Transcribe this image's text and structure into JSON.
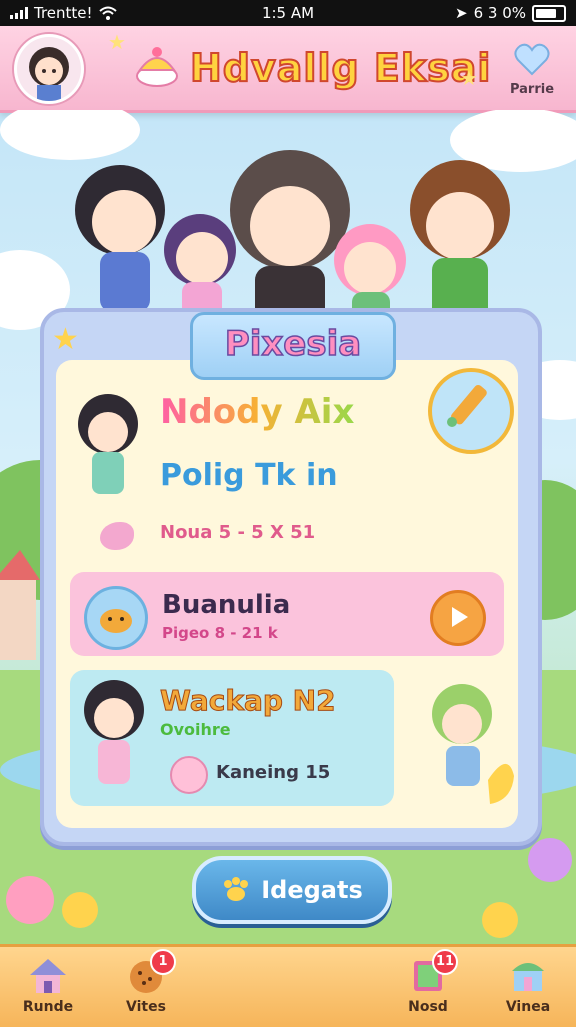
{
  "status": {
    "carrier": "Trentte!",
    "time": "1:5 AM",
    "battery": "6 3 0%"
  },
  "header": {
    "title": "Hdvallg Eksai",
    "profile_label": "Parrie"
  },
  "panel": {
    "ribbon": "Pixesia",
    "card1": {
      "title": "Ndody Aix",
      "subtitle": "Polig Tk in",
      "meta": "Noua 5 - 5 X 51"
    },
    "card2": {
      "title": "Buanulia",
      "meta": "Pigeo 8 - 21 k"
    },
    "card3": {
      "title": "Wackap N2",
      "subtitle": "Ovoihre",
      "meta": "Kaneing 15"
    }
  },
  "update_button": {
    "label": "Idegats"
  },
  "tabs": [
    {
      "label": "Runde",
      "icon": "house-icon",
      "badge": null
    },
    {
      "label": "Vites",
      "icon": "cookie-icon",
      "badge": "1"
    },
    {
      "label": "Nosd",
      "icon": "book-icon",
      "badge": "11"
    },
    {
      "label": "Vinea",
      "icon": "shop-icon",
      "badge": null
    }
  ],
  "colors": {
    "accent_pink": "#f7b6cf",
    "tab_orange": "#f6b55a",
    "button_blue": "#3f89c7"
  }
}
